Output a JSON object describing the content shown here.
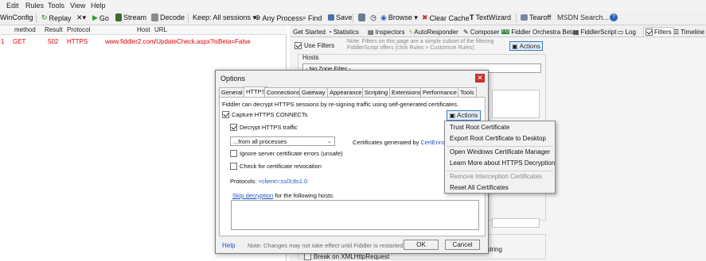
{
  "menu": [
    "Edit",
    "Rules",
    "Tools",
    "View",
    "Help"
  ],
  "toolbar": {
    "winconfig": "WinConfig",
    "replay": "Replay",
    "remove": "✕▾",
    "go": "Go",
    "stream": "Stream",
    "decode": "Decode",
    "keep": "Keep: All sessions ▾",
    "any_process": "Any Process",
    "find": "Find",
    "save": "Save",
    "browse": "Browse ▾",
    "clear_cache": "Clear Cache",
    "textwizard": "TextWizard",
    "tearoff": "Tearoff",
    "msdn_search": "MSDN Search..."
  },
  "sessions": {
    "columns": [
      "method",
      "Result",
      "Protocol",
      "Host",
      "URL"
    ],
    "rows": [
      {
        "num": "1",
        "method": "GET",
        "result": "502",
        "protocol": "HTTPS",
        "host": "www.fiddler2.com",
        "url": "/UpdateCheck.aspx?isBeta=False"
      }
    ]
  },
  "tabs": [
    "Get Started",
    "Statistics",
    "Inspectors",
    "AutoResponder",
    "Composer",
    "Fiddler Orchestra Beta",
    "FiddlerScript",
    "Log",
    "Filters",
    "Timeline"
  ],
  "filters": {
    "use_filters": "Use Filters",
    "note": "Note: Filters on this page are a simple subset of the filtering FiddlerScript offers (click Rules > Customize Rules).",
    "actions": "Actions",
    "hosts_label": "Hosts",
    "zone_filter": "- No Zone Filter -",
    "query_string": "ery string",
    "break_xhr": "Break on XMLHttpRequest"
  },
  "dialog": {
    "title": "Options",
    "close": "✕",
    "tabs": [
      "General",
      "HTTPS",
      "Connections",
      "Gateway",
      "Appearance",
      "Scripting",
      "Extensions",
      "Performance",
      "Tools"
    ],
    "active_tab": "HTTPS",
    "intro": "Fiddler can decrypt HTTPS sessions by re-signing traffic using self-generated certificates.",
    "capture_connects": "Capture HTTPS CONNECTs",
    "decrypt_traffic": "Decrypt HTTPS traffic",
    "process_select": "...from all processes",
    "certs_generated_prefix": "Certificates generated by ",
    "certs_generated_link": "CertEnroll e",
    "ignore_errors": "Ignore server certificate errors (unsafe)",
    "check_revocation": "Check for certificate revocation",
    "protocols_label": "Protocols: ",
    "protocols_value": "<client>;ssl3;tls1.0",
    "skip_link": "Skip decryption",
    "skip_suffix": " for the following hosts:",
    "actions_btn": "Actions",
    "help": "Help",
    "footer_note": "Note: Changes may not take effect until Fiddler is restarted.",
    "ok": "OK",
    "cancel": "Cancel"
  },
  "context_menu": {
    "items": [
      {
        "label": "Trust Root Certificate",
        "enabled": true
      },
      {
        "label": "Export Root Certificate to Desktop",
        "enabled": true
      },
      {
        "label": "Open Windows Certificate Manager",
        "enabled": true
      },
      {
        "label": "Learn More about HTTPS Decryption",
        "enabled": true
      },
      {
        "label": "Remove Interception Certificates",
        "enabled": false
      },
      {
        "label": "Reset All Certificates",
        "enabled": true
      }
    ]
  },
  "colors": {
    "error_row": "#e00000",
    "link": "#1a55c6",
    "close_button": "#c9302c",
    "focus_border": "#3a79c9"
  }
}
